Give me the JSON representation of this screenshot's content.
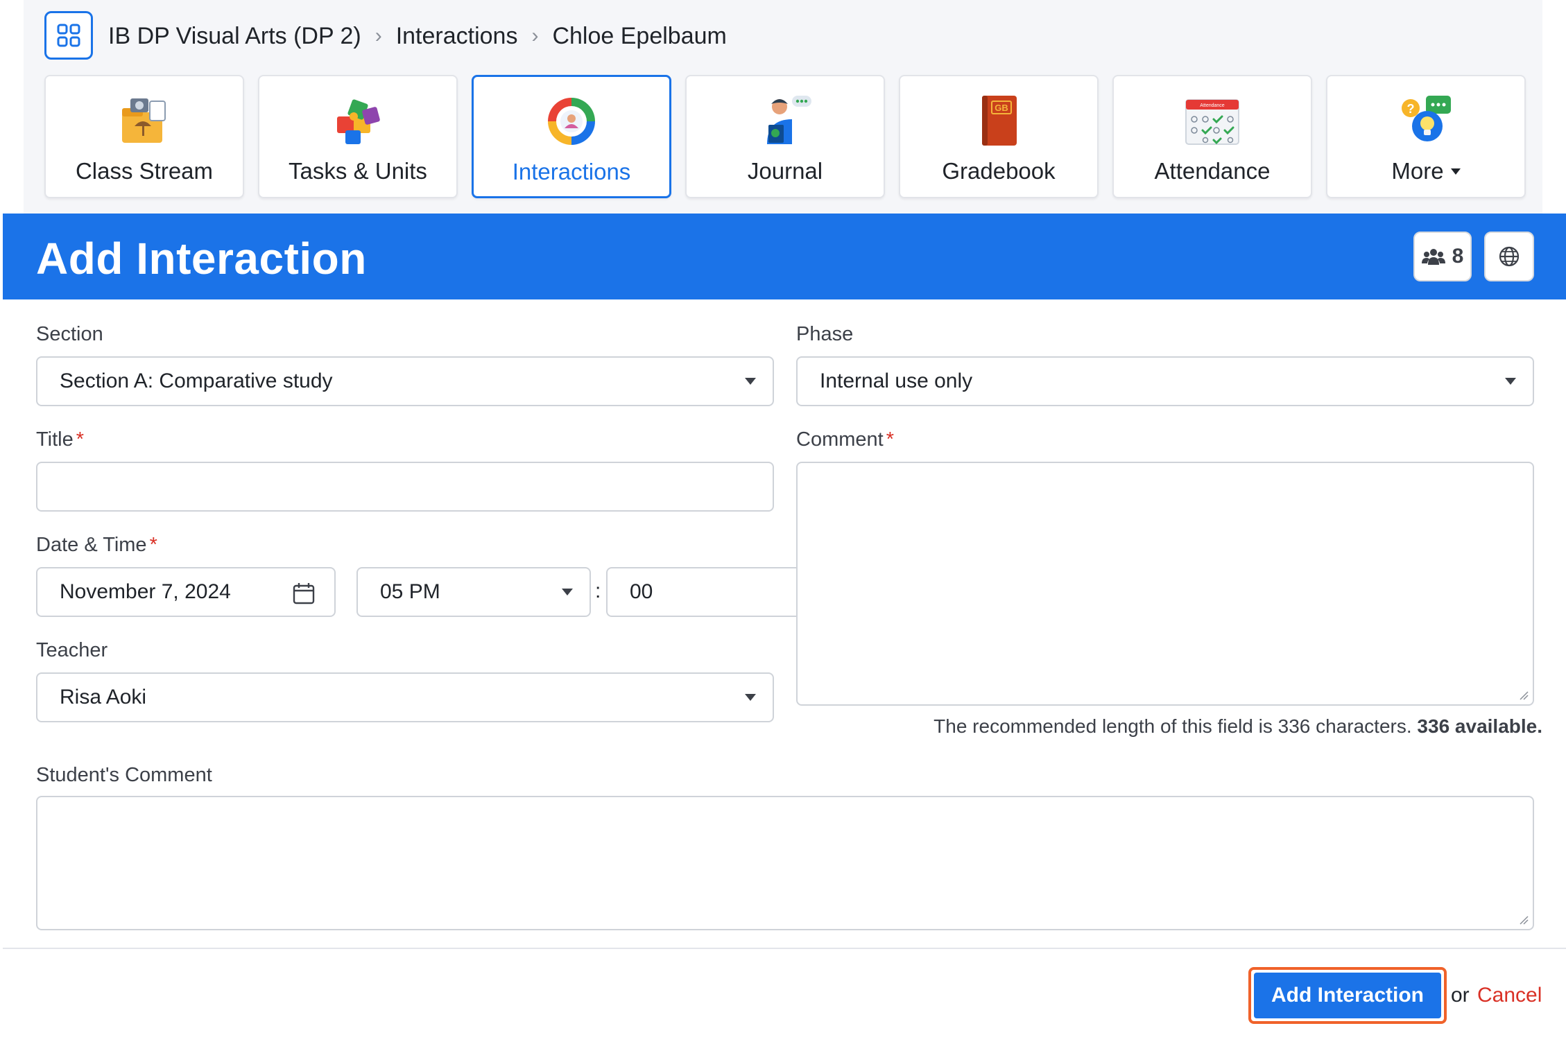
{
  "breadcrumb": [
    "IB DP Visual Arts (DP 2)",
    "Interactions",
    "Chloe Epelbaum"
  ],
  "tabs": [
    {
      "label": "Class Stream",
      "icon": "class-stream-icon"
    },
    {
      "label": "Tasks & Units",
      "icon": "puzzle-icon"
    },
    {
      "label": "Interactions",
      "icon": "interactions-cycle-icon",
      "active": true
    },
    {
      "label": "Journal",
      "icon": "journal-person-icon"
    },
    {
      "label": "Gradebook",
      "icon": "gradebook-book-icon",
      "badge": "GB"
    },
    {
      "label": "Attendance",
      "icon": "attendance-calendar-icon",
      "badge": "Attendance"
    },
    {
      "label": "More",
      "icon": "question-bulb-icon"
    }
  ],
  "header": {
    "title": "Add Interaction",
    "people_count": "8"
  },
  "form": {
    "section": {
      "label": "Section",
      "value": "Section A: Comparative study"
    },
    "phase": {
      "label": "Phase",
      "value": "Internal use only"
    },
    "title": {
      "label": "Title",
      "value": ""
    },
    "comment": {
      "label": "Comment",
      "value": "",
      "hint_prefix": "The recommended length of this field is 336 characters.",
      "hint_available": "336 available."
    },
    "datetime": {
      "label": "Date & Time",
      "date": "November 7, 2024",
      "hour": "05 PM",
      "sep": ":",
      "minute": "00"
    },
    "teacher": {
      "label": "Teacher",
      "value": "Risa Aoki"
    },
    "student_comment": {
      "label": "Student's Comment",
      "value": ""
    },
    "required_mark": "*"
  },
  "footer": {
    "submit_label": "Add Interaction",
    "or_text": "or",
    "cancel_label": "Cancel"
  },
  "colors": {
    "primary": "#1b73e8",
    "danger": "#d93025",
    "focus": "#f0622a"
  }
}
